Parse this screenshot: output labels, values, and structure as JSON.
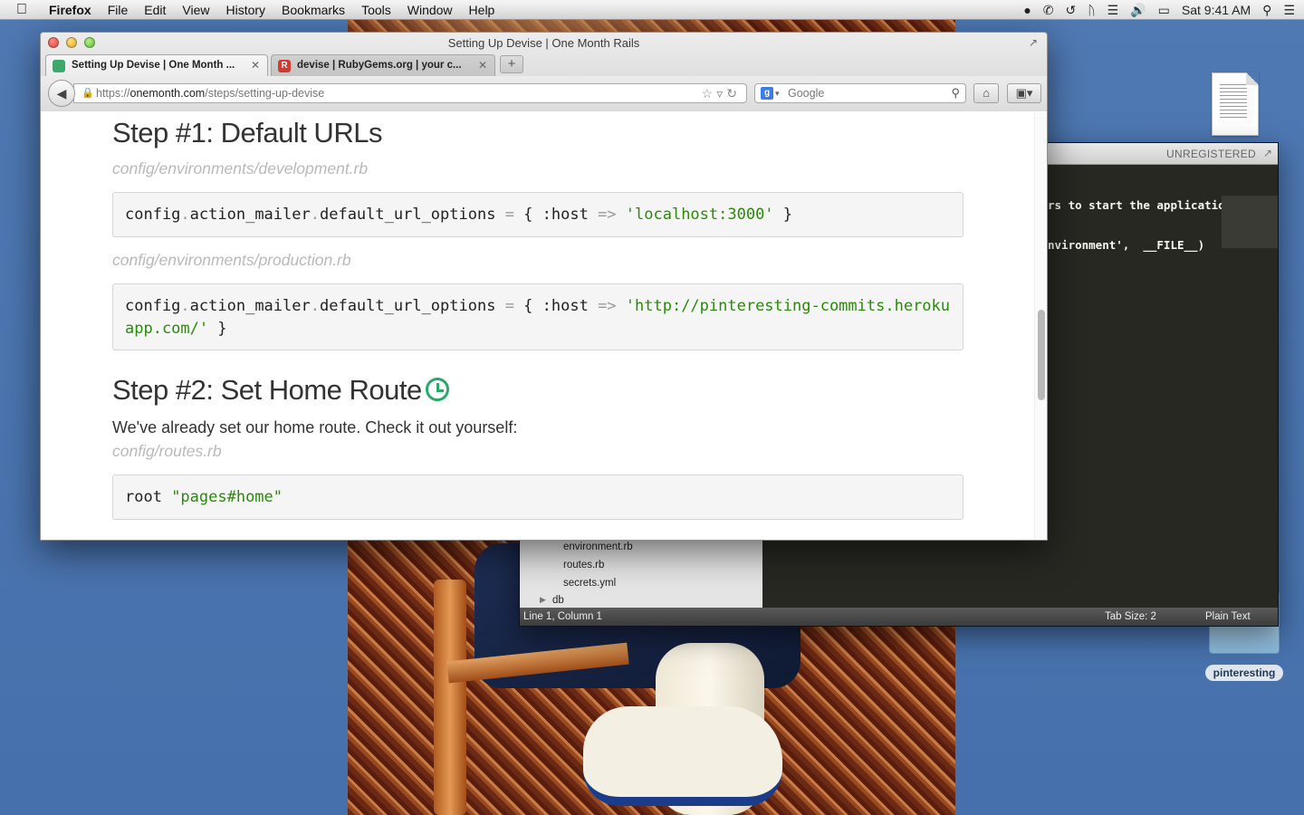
{
  "menubar": {
    "app_name": "Firefox",
    "items": [
      "File",
      "Edit",
      "View",
      "History",
      "Bookmarks",
      "Tools",
      "Window",
      "Help"
    ],
    "clock": "Sat 9:41 AM"
  },
  "desktop": {
    "folder_label": "pinteresting"
  },
  "editor": {
    "unregistered": "UNREGISTERED",
    "code_line1": "rs to start the application",
    "code_line2": "nvironment',  __FILE__)",
    "files": [
      "environment.rb",
      "routes.rb",
      "secrets.yml",
      "db"
    ],
    "status_position": "Line 1, Column 1",
    "status_tabsize": "Tab Size: 2",
    "status_syntax": "Plain Text"
  },
  "browser": {
    "window_title": "Setting Up Devise | One Month Rails",
    "tabs": [
      {
        "label": "Setting Up Devise | One Month ...",
        "active": true
      },
      {
        "label": "devise | RubyGems.org | your c...",
        "active": false
      }
    ],
    "url_prefix": "https://",
    "url_host": "onemonth.com",
    "url_path": "/steps/setting-up-devise",
    "search_placeholder": "Google"
  },
  "page": {
    "step1_title": "Step #1: Default URLs",
    "path_dev": "config/environments/development.rb",
    "code_dev": {
      "prefix": "config",
      "dot1": ".",
      "mid1": "action_mailer",
      "dot2": ".",
      "mid2": "default_url_options",
      "eq": " = ",
      "open": "{ :host ",
      "arrow": "=>",
      "str": " 'localhost:3000'",
      "close": " }"
    },
    "path_prod": "config/environments/production.rb",
    "code_prod": {
      "prefix": "config",
      "dot1": ".",
      "mid1": "action_mailer",
      "dot2": ".",
      "mid2": "default_url_options",
      "eq": " = ",
      "open": "{ :host ",
      "arrow": "=>",
      "str": " 'http://pinteresting-commits.herokuapp.com/'",
      "close": " }"
    },
    "step2_title": "Step #2: Set Home Route",
    "step2_text": "We've already set our home route. Check it out yourself:",
    "path_routes": "config/routes.rb",
    "code_routes": {
      "kw": "root ",
      "str": "\"pages#home\""
    }
  }
}
